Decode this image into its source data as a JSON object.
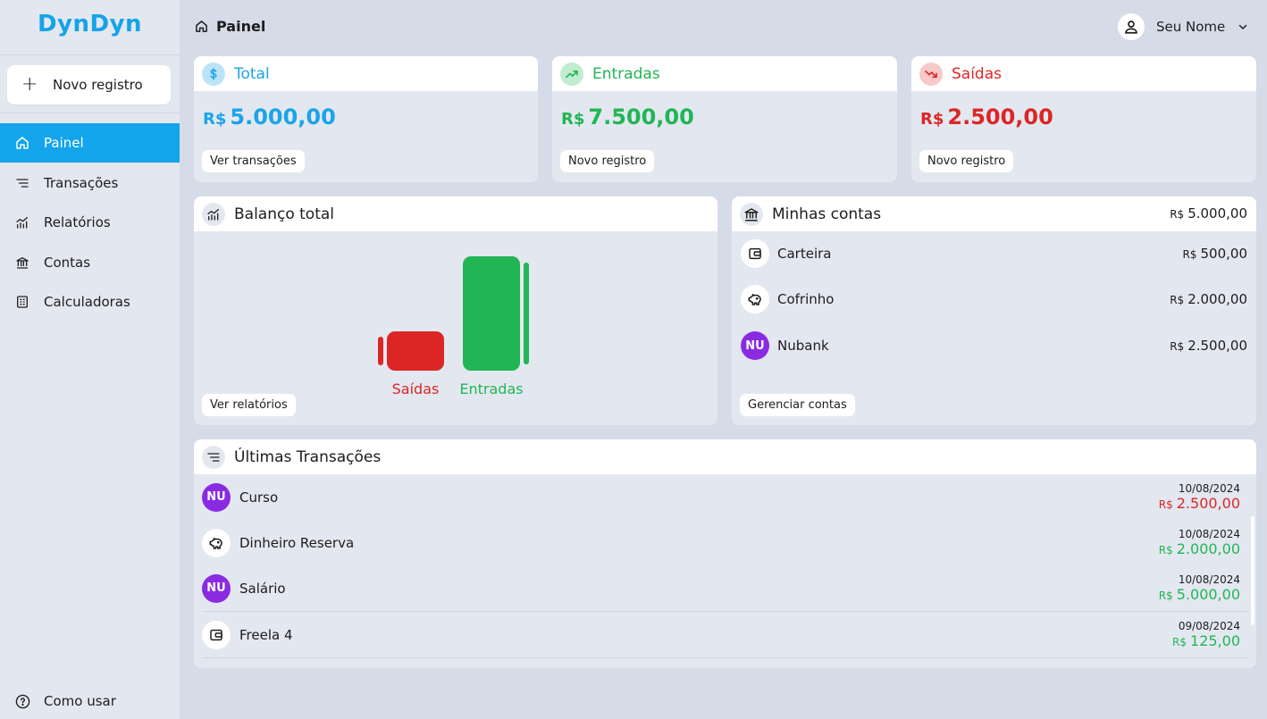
{
  "app": {
    "logo": "DynDyn"
  },
  "sidebar": {
    "new_button": "Novo registro",
    "items": [
      {
        "label": "Painel",
        "icon": "home-icon",
        "active": true
      },
      {
        "label": "Transações",
        "icon": "list-icon",
        "active": false
      },
      {
        "label": "Relatórios",
        "icon": "chart-icon",
        "active": false
      },
      {
        "label": "Contas",
        "icon": "bank-icon",
        "active": false
      },
      {
        "label": "Calculadoras",
        "icon": "calculator-icon",
        "active": false
      }
    ],
    "help": "Como usar"
  },
  "header": {
    "breadcrumb": "Painel",
    "user_name": "Seu Nome"
  },
  "summary": {
    "total": {
      "title": "Total",
      "currency": "R$",
      "value": "5.000,00",
      "action": "Ver transações",
      "color": "#1ba4e8"
    },
    "income": {
      "title": "Entradas",
      "currency": "R$",
      "value": "7.500,00",
      "action": "Novo registro",
      "color": "#22b555"
    },
    "expense": {
      "title": "Saídas",
      "currency": "R$",
      "value": "2.500,00",
      "action": "Novo registro",
      "color": "#dc2626"
    }
  },
  "balance": {
    "title": "Balanço total",
    "action": "Ver relatórios"
  },
  "chart_data": {
    "type": "bar",
    "categories": [
      "Saídas",
      "Entradas"
    ],
    "values": [
      2500,
      7500
    ],
    "colors": [
      "#dc2626",
      "#22b555"
    ]
  },
  "accounts": {
    "title": "Minhas contas",
    "total_currency": "R$",
    "total": "5.000,00",
    "items": [
      {
        "name": "Carteira",
        "currency": "R$",
        "amount": "500,00",
        "icon": "wallet-icon"
      },
      {
        "name": "Cofrinho",
        "currency": "R$",
        "amount": "2.000,00",
        "icon": "piggy-bank-icon"
      },
      {
        "name": "Nubank",
        "currency": "R$",
        "amount": "2.500,00",
        "icon": "NU"
      }
    ],
    "action": "Gerenciar contas"
  },
  "transactions": {
    "title": "Últimas Transações",
    "items": [
      {
        "name": "Curso",
        "date": "10/08/2024",
        "currency": "R$",
        "amount": "2.500,00",
        "type": "out",
        "icon": "NU"
      },
      {
        "name": "Dinheiro Reserva",
        "date": "10/08/2024",
        "currency": "R$",
        "amount": "2.000,00",
        "type": "in",
        "icon": "piggy-bank-icon"
      },
      {
        "name": "Salário",
        "date": "10/08/2024",
        "currency": "R$",
        "amount": "5.000,00",
        "type": "in",
        "icon": "NU"
      },
      {
        "name": "Freela 4",
        "date": "09/08/2024",
        "currency": "R$",
        "amount": "125,00",
        "type": "in",
        "icon": "wallet-icon"
      }
    ]
  }
}
